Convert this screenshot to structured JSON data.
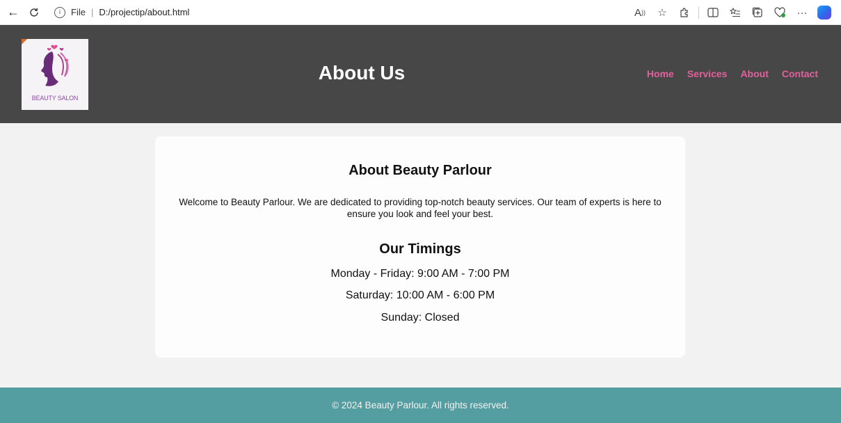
{
  "browser": {
    "file_label": "File",
    "address": "D:/projectip/about.html"
  },
  "header": {
    "logo_text": "BEAUTY SALON",
    "title": "About Us",
    "nav": [
      "Home",
      "Services",
      "About",
      "Contact"
    ]
  },
  "about": {
    "heading": "About Beauty Parlour",
    "text": "Welcome to Beauty Parlour. We are dedicated to providing top-notch beauty services. Our team of experts is here to ensure you look and feel your best."
  },
  "timings": {
    "heading": "Our Timings",
    "items": [
      "Monday - Friday: 9:00 AM - 7:00 PM",
      "Saturday: 10:00 AM - 6:00 PM",
      "Sunday: Closed"
    ]
  },
  "footer": {
    "text": "© 2024 Beauty Parlour. All rights reserved."
  },
  "colors": {
    "header_bg": "#474747",
    "nav_link": "#e1619c",
    "footer_bg": "#549da0",
    "page_bg": "#f2f2f2"
  }
}
